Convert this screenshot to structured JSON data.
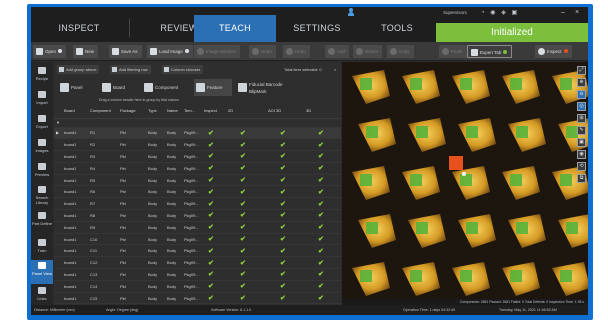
{
  "app": {
    "status": "Initialized",
    "user": "Supervisors",
    "window_controls": {
      "minimize": "–",
      "close": "×"
    }
  },
  "nav": {
    "tabs": [
      {
        "label": "INSPECT"
      },
      {
        "label": "REVIEW"
      },
      {
        "label": "TEACH",
        "active": true
      },
      {
        "label": "SETTINGS"
      },
      {
        "label": "TOOLS"
      }
    ]
  },
  "toolbar": {
    "open": "Open",
    "new": "New",
    "save_as": "Save As",
    "load_image": "Load Image",
    "image_window": "Image Window",
    "undo": "Undo",
    "redo": "Redo",
    "add": "Add",
    "delete": "Delete",
    "copy": "Copy",
    "paste": "Paste",
    "expert_tab": "Expert Tab",
    "inspect": "Inspect"
  },
  "sidebar": {
    "items": [
      {
        "label": "Recipe"
      },
      {
        "label": "Import"
      },
      {
        "label": "Export"
      },
      {
        "label": "Images"
      },
      {
        "label": "Preview"
      },
      {
        "label": "Search Library"
      },
      {
        "label": "Part Define"
      },
      {
        "label": "Train"
      },
      {
        "label": "Panel View",
        "active": true
      },
      {
        "label": "Links"
      }
    ]
  },
  "panel": {
    "tools": [
      "Add group above",
      "Add filtering row",
      "Column chooser"
    ],
    "total_text": "Total item selected: 0",
    "tabs": [
      "Panel",
      "Board",
      "Component",
      "Feature",
      "Fiducial Barcode BlipMark"
    ],
    "message": "Drag a column header here to group by that column",
    "columns": [
      "Board",
      "Component",
      "Package",
      "Type",
      "Name",
      "Tem...",
      "Inspect",
      "2D",
      "AOI 3D",
      "3D"
    ],
    "rows": [
      {
        "board": "board1",
        "component": "R1",
        "package": "Pkt",
        "type": "Body",
        "name": "Body",
        "tem": "Pkg09...",
        "inspect": "✔",
        "c2d": "✔",
        "aoi3d": "✔",
        "c3d": "✔"
      },
      {
        "board": "board1",
        "component": "R2",
        "package": "Pkt",
        "type": "Body",
        "name": "Body",
        "tem": "Pkg09...",
        "inspect": "✔",
        "c2d": "✔",
        "aoi3d": "✔",
        "c3d": "✔"
      },
      {
        "board": "board1",
        "component": "R3",
        "package": "Pkt",
        "type": "Body",
        "name": "Body",
        "tem": "Pkg09...",
        "inspect": "✔",
        "c2d": "✔",
        "aoi3d": "✔",
        "c3d": "✔"
      },
      {
        "board": "board1",
        "component": "R4",
        "package": "Pkt",
        "type": "Body",
        "name": "Body",
        "tem": "Pkg09...",
        "inspect": "✔",
        "c2d": "✔",
        "aoi3d": "✔",
        "c3d": "✔"
      },
      {
        "board": "board1",
        "component": "R5",
        "package": "Pkt",
        "type": "Body",
        "name": "Body",
        "tem": "Pkg09...",
        "inspect": "✔",
        "c2d": "✔",
        "aoi3d": "✔",
        "c3d": "✔"
      },
      {
        "board": "board1",
        "component": "R6",
        "package": "Pkt",
        "type": "Body",
        "name": "Body",
        "tem": "Pkg09...",
        "inspect": "✔",
        "c2d": "✔",
        "aoi3d": "✔",
        "c3d": "✔"
      },
      {
        "board": "board1",
        "component": "R7",
        "package": "Pkt",
        "type": "Body",
        "name": "Body",
        "tem": "Pkg09...",
        "inspect": "✔",
        "c2d": "✔",
        "aoi3d": "✔",
        "c3d": "✔"
      },
      {
        "board": "board1",
        "component": "R8",
        "package": "Pkt",
        "type": "Body",
        "name": "Body",
        "tem": "Pkg09...",
        "inspect": "✔",
        "c2d": "✔",
        "aoi3d": "✔",
        "c3d": "✔"
      },
      {
        "board": "board1",
        "component": "R9",
        "package": "Pkt",
        "type": "Body",
        "name": "Body",
        "tem": "Pkg09...",
        "inspect": "✔",
        "c2d": "✔",
        "aoi3d": "✔",
        "c3d": "✔"
      },
      {
        "board": "board1",
        "component": "C10",
        "package": "Pkt",
        "type": "Body",
        "name": "Body",
        "tem": "Pkg09...",
        "inspect": "✔",
        "c2d": "✔",
        "aoi3d": "✔",
        "c3d": "✔"
      },
      {
        "board": "board1",
        "component": "C11",
        "package": "Pkt",
        "type": "Body",
        "name": "Body",
        "tem": "Pkg09...",
        "inspect": "✔",
        "c2d": "✔",
        "aoi3d": "✔",
        "c3d": "✔"
      },
      {
        "board": "board1",
        "component": "C12",
        "package": "Pkt",
        "type": "Body",
        "name": "Body",
        "tem": "Pkg09...",
        "inspect": "✔",
        "c2d": "✔",
        "aoi3d": "✔",
        "c3d": "✔"
      },
      {
        "board": "board1",
        "component": "C13",
        "package": "Pkt",
        "type": "Body",
        "name": "Body",
        "tem": "Pkg09...",
        "inspect": "✔",
        "c2d": "✔",
        "aoi3d": "✔",
        "c3d": "✔"
      },
      {
        "board": "board1",
        "component": "C14",
        "package": "Pkt",
        "type": "Body",
        "name": "Body",
        "tem": "Pkg09...",
        "inspect": "✔",
        "c2d": "✔",
        "aoi3d": "✔",
        "c3d": "✔"
      },
      {
        "board": "board1",
        "component": "C15",
        "package": "Pkt",
        "type": "Body",
        "name": "Body",
        "tem": "Pkg09...",
        "inspect": "✔",
        "c2d": "✔",
        "aoi3d": "✔",
        "c3d": "✔"
      },
      {
        "board": "board1",
        "component": "C16",
        "package": "Pkt",
        "type": "Body",
        "name": "Body",
        "tem": "Pkg09...",
        "inspect": "✔",
        "c2d": "✔",
        "aoi3d": "✔",
        "c3d": "✔"
      }
    ]
  },
  "image_view": {
    "tools": [
      "⤢",
      "⊕",
      "⊖",
      "◎",
      "⊞",
      "✎",
      "▣",
      "◉",
      "⟲",
      "⧉"
    ],
    "status": "Components: 2681  Passed: 2681  Failed: 0  Total Defects: 0  Inspection Time: 1.35 s"
  },
  "statusbar": {
    "distance": "Distance: Millimeter (mm)",
    "angle": "Angle: Degree (deg)",
    "software": "Software Version: 6.1.1.0",
    "operation_time": "Operation Time: 1 days 04:32:49",
    "date": "Tuesday, May 11, 2021  11:46:52 AM"
  },
  "colors": {
    "accent": "#2b6fb4",
    "status": "#7bbf3c",
    "check": "#8fd03c",
    "frame": "#0f6fd0",
    "pad": "#58b13a",
    "part": "#d6a026",
    "defect": "#e8501e"
  }
}
